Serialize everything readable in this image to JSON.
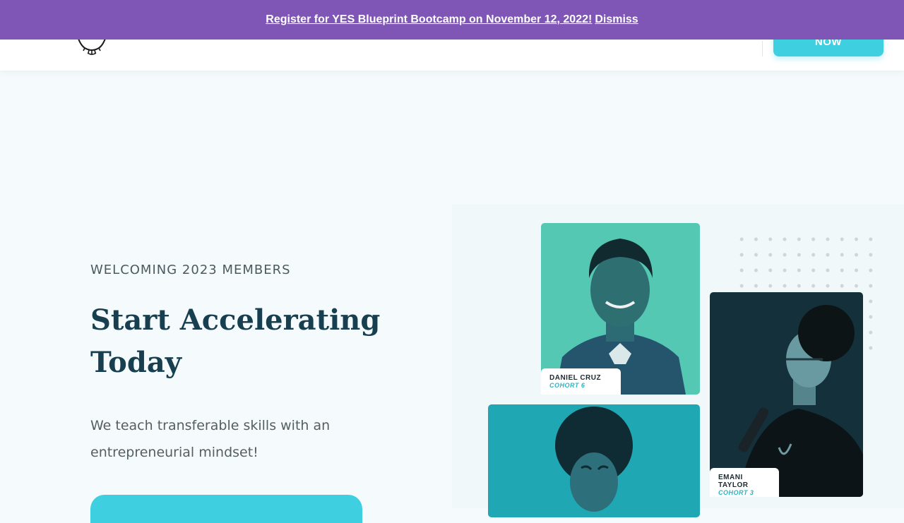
{
  "banner": {
    "link_text": "Register for YES Blueprint Bootcamp on November 12, 2022!",
    "dismiss_label": "Dismiss"
  },
  "header": {
    "cta_label": "NOW"
  },
  "hero": {
    "eyebrow": "WELCOMING 2023 MEMBERS",
    "title": "Start Accelerating Today",
    "subtitle": "We teach transferable skills with an entrepreneurial mindset!"
  },
  "members": [
    {
      "name": "DANIEL CRUZ",
      "cohort": "COHORT 6"
    },
    {
      "name": "EMANI TAYLOR",
      "cohort": "COHORT 3"
    }
  ],
  "colors": {
    "banner": "#7f56b5",
    "accent": "#3ecfe0",
    "heading": "#173f4f",
    "background": "#f5fbfc"
  },
  "icons": {
    "logo": "brand-logo-icon"
  }
}
